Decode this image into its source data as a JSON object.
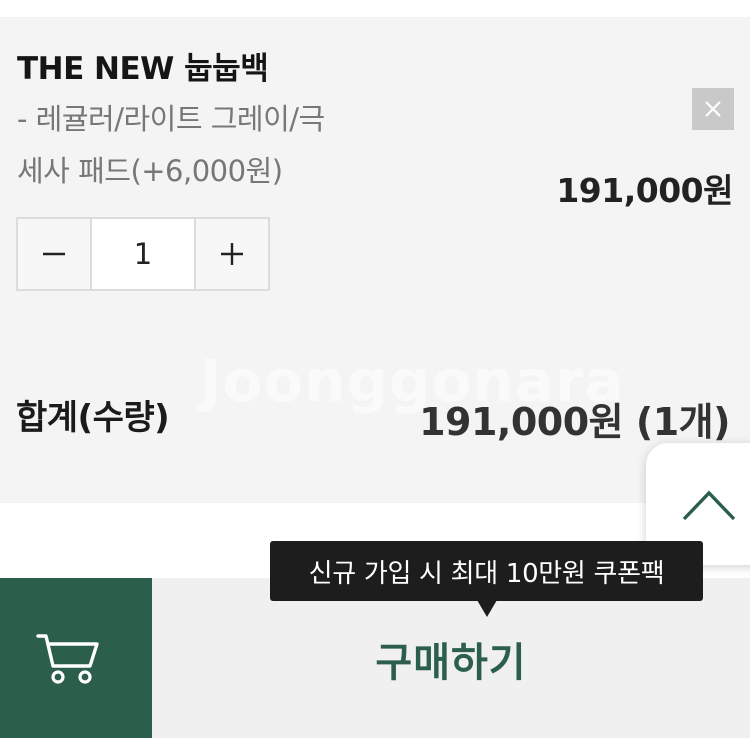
{
  "product": {
    "name": "THE NEW 눕눕백",
    "option_line1": "- 레귤러/라이트 그레이/극",
    "option_line2": "세사 패드(+6,000원)",
    "price": "191,000원",
    "quantity": "1"
  },
  "stepper": {
    "minus_label": "−",
    "plus_label": "+"
  },
  "total": {
    "label": "합계(수량)",
    "value": "191,000원 (1개)"
  },
  "watermark": "Joonggonara",
  "tooltip": {
    "text": "신규 가입 시 최대 10만원 쿠폰팩"
  },
  "actions": {
    "buy_label": "구매하기"
  },
  "icons": {
    "remove": "close-icon",
    "scroll_top": "chevron-up-icon",
    "cart": "cart-icon"
  },
  "colors": {
    "brand_green": "#2b5e4b",
    "card_bg": "#f4f4f4",
    "tooltip_bg": "#1d1d1d"
  }
}
